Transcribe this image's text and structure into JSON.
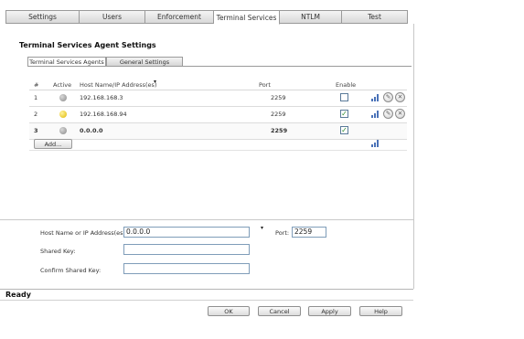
{
  "top_tabs": [
    "Settings",
    "Users",
    "Enforcement",
    "Terminal Services",
    "NTLM",
    "Test"
  ],
  "section_title": "Terminal Services Agent Settings",
  "sub_tabs": [
    "Terminal Services Agents",
    "General Settings"
  ],
  "table": {
    "headers": {
      "num": "#",
      "active": "Active",
      "host": "Host Name/IP Address(es)",
      "port": "Port",
      "enable": "Enable"
    },
    "rows": [
      {
        "num": "1",
        "status": "gray",
        "host": "192.168.168.3",
        "port": "2259",
        "enabled": false,
        "bold": false
      },
      {
        "num": "2",
        "status": "yellow",
        "host": "192.168.168.94",
        "port": "2259",
        "enabled": true,
        "bold": false
      },
      {
        "num": "3",
        "status": "gray",
        "host": "0.0.0.0",
        "port": "2259",
        "enabled": true,
        "bold": true
      }
    ],
    "add_label": "Add..."
  },
  "form": {
    "host_label": "Host Name or IP Address(es):",
    "host_value": "0.0.0.0",
    "port_label": "Port:",
    "port_value": "2259",
    "shared_key_label": "Shared Key:",
    "confirm_key_label": "Confirm Shared Key:"
  },
  "status": "Ready",
  "buttons": {
    "ok": "OK",
    "cancel": "Cancel",
    "apply": "Apply",
    "help": "Help"
  },
  "icons": {
    "status_gray": "status-dot-gray",
    "status_yellow": "status-dot-yellow",
    "stats": "statistics-icon",
    "configure": "pencil-icon",
    "delete": "delete-x-icon"
  },
  "colors": {
    "active_status": "#e0b800",
    "inactive_status": "#8a8a8a",
    "checkmark": "#2e8b2e",
    "input_border": "#7f9db9"
  }
}
